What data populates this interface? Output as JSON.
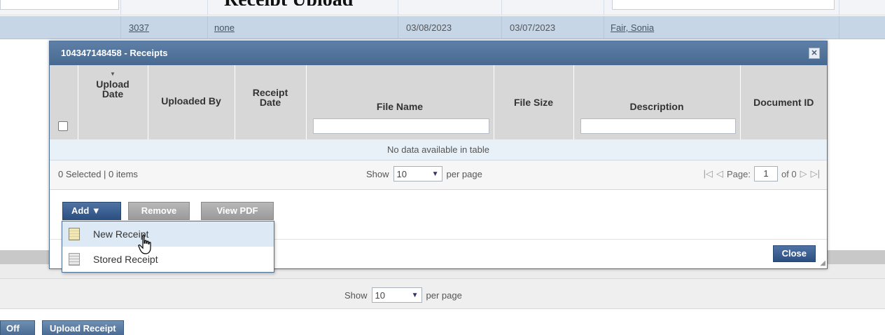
{
  "background": {
    "heading": "Receipt Upload",
    "row": {
      "id": "3037",
      "type": "none",
      "date1": "03/08/2023",
      "date2": "03/07/2023",
      "person": "Fair, Sonia"
    },
    "footer_show": "Show",
    "footer_per_page_value": "10",
    "footer_per_page": "per page",
    "bottom_buttons": [
      "Off",
      "Upload Receipt"
    ]
  },
  "modal": {
    "title": "104347148458 - Receipts",
    "close_x": "✕",
    "columns": [
      "Upload Date",
      "Uploaded By",
      "Receipt Date",
      "File Name",
      "File Size",
      "Description",
      "Document ID"
    ],
    "no_data": "No data available in table",
    "selection_summary": "0 Selected | 0 items",
    "show_label": "Show",
    "per_page_value": "10",
    "per_page_label": "per page",
    "page_label": "Page:",
    "page_value": "1",
    "page_of": "of 0",
    "buttons": {
      "add": "Add ▼",
      "remove": "Remove",
      "view_pdf": "View PDF",
      "close": "Close"
    }
  },
  "add_menu": {
    "items": [
      "New Receipt",
      "Stored Receipt"
    ],
    "icons": [
      "receipt-icon",
      "stored-receipt-icon"
    ],
    "hovered_index": 0
  },
  "colors": {
    "title_bar": "#5276a0",
    "primary_button": "#3b5f8f",
    "disabled_button": "#a8a8a8",
    "selected_row": "#c6d6e6"
  }
}
